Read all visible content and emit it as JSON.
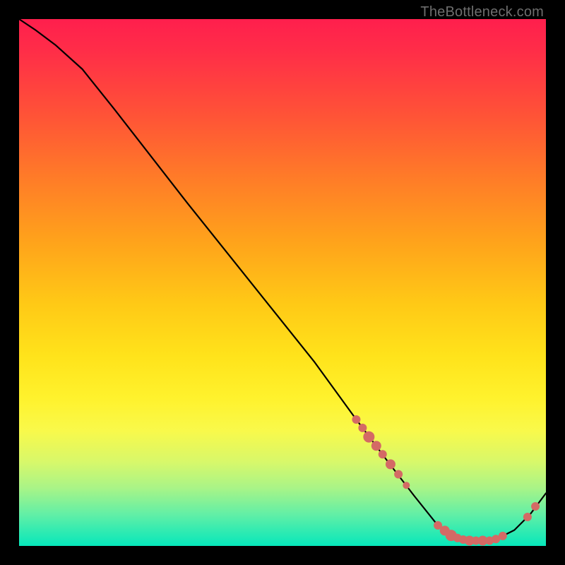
{
  "watermark": "TheBottleneck.com",
  "chart_data": {
    "type": "line",
    "title": "",
    "xlabel": "",
    "ylabel": "",
    "xlim": [
      0,
      100
    ],
    "ylim": [
      0,
      100
    ],
    "grid": false,
    "series": [
      {
        "name": "curve",
        "x": [
          0,
          3,
          7,
          12,
          18,
          25,
          32,
          40,
          48,
          56,
          64,
          70,
          75,
          79,
          82,
          86,
          90,
          94,
          97,
          100
        ],
        "y": [
          100,
          98,
          95,
          90.5,
          83,
          74,
          65,
          55,
          45,
          35,
          24,
          16,
          9.5,
          4.5,
          2,
          1,
          1,
          3,
          6,
          10
        ]
      }
    ],
    "markers": [
      {
        "x": 64.0,
        "y": 24.0,
        "r": 6
      },
      {
        "x": 65.2,
        "y": 22.4,
        "r": 6
      },
      {
        "x": 66.4,
        "y": 20.7,
        "r": 8
      },
      {
        "x": 67.8,
        "y": 19.0,
        "r": 7
      },
      {
        "x": 69.0,
        "y": 17.4,
        "r": 6
      },
      {
        "x": 70.5,
        "y": 15.5,
        "r": 7
      },
      {
        "x": 72.0,
        "y": 13.6,
        "r": 6
      },
      {
        "x": 73.5,
        "y": 11.5,
        "r": 5
      },
      {
        "x": 79.5,
        "y": 3.9,
        "r": 6
      },
      {
        "x": 80.8,
        "y": 2.9,
        "r": 7
      },
      {
        "x": 82.0,
        "y": 2.0,
        "r": 8
      },
      {
        "x": 83.2,
        "y": 1.5,
        "r": 6
      },
      {
        "x": 84.3,
        "y": 1.2,
        "r": 6
      },
      {
        "x": 85.5,
        "y": 1.0,
        "r": 7
      },
      {
        "x": 86.7,
        "y": 1.0,
        "r": 6
      },
      {
        "x": 88.0,
        "y": 1.0,
        "r": 7
      },
      {
        "x": 89.3,
        "y": 1.0,
        "r": 6
      },
      {
        "x": 90.5,
        "y": 1.3,
        "r": 6
      },
      {
        "x": 91.8,
        "y": 1.9,
        "r": 6
      },
      {
        "x": 96.5,
        "y": 5.5,
        "r": 6
      },
      {
        "x": 98.0,
        "y": 7.5,
        "r": 6
      }
    ],
    "gradient_stops": [
      {
        "pos": 0,
        "color": "#ff1f4d"
      },
      {
        "pos": 18,
        "color": "#ff5237"
      },
      {
        "pos": 42,
        "color": "#ffa21b"
      },
      {
        "pos": 64,
        "color": "#ffe31b"
      },
      {
        "pos": 84,
        "color": "#d8f86a"
      },
      {
        "pos": 100,
        "color": "#06e7bb"
      }
    ]
  }
}
